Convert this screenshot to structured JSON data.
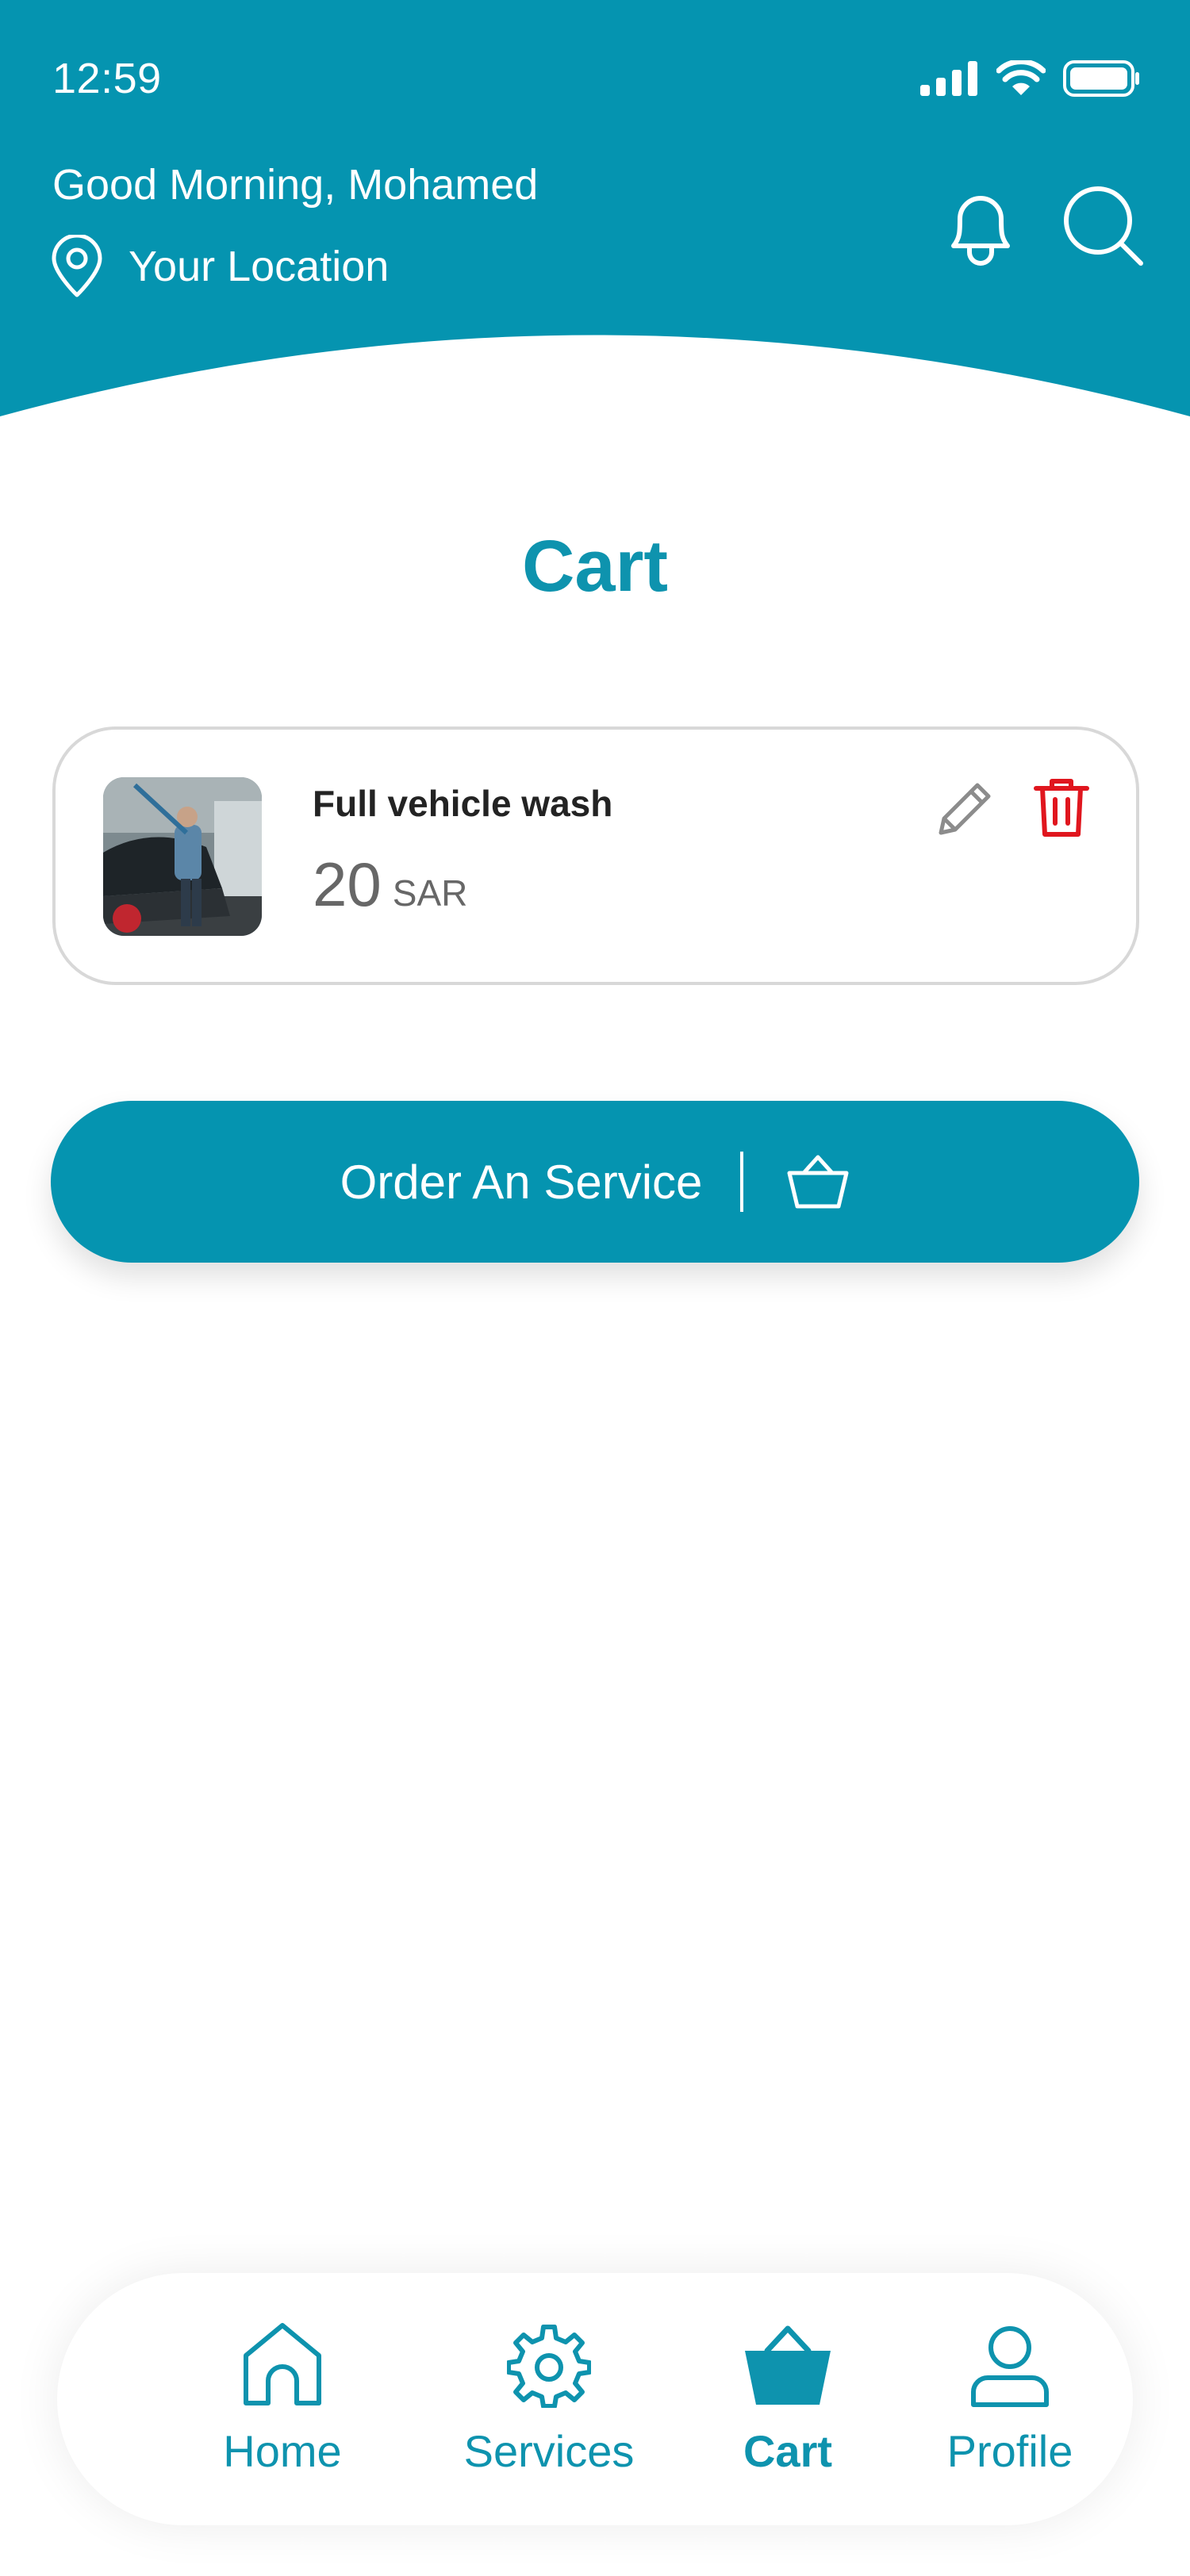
{
  "status_bar": {
    "time": "12:59"
  },
  "header": {
    "greeting": "Good Morning, Mohamed",
    "location_label": "Your Location",
    "icons": [
      "location-pin-icon",
      "bell-icon",
      "search-icon"
    ]
  },
  "page": {
    "title": "Cart"
  },
  "cart": {
    "items": [
      {
        "name": "Full vehicle wash",
        "price": "20",
        "currency": "SAR",
        "image": "car-wash-photo"
      }
    ]
  },
  "order_button": {
    "label": "Order An Service",
    "icon": "basket-icon"
  },
  "bottom_nav": {
    "items": [
      {
        "label": "Home",
        "icon": "home-icon",
        "active": false
      },
      {
        "label": "Services",
        "icon": "gear-icon",
        "active": false
      },
      {
        "label": "Cart",
        "icon": "basket-icon",
        "active": true
      },
      {
        "label": "Profile",
        "icon": "user-icon",
        "active": false
      }
    ]
  },
  "colors": {
    "primary": "#0594b0",
    "title": "#0e93ae",
    "delete": "#e0161e",
    "edit": "#8c8c8c",
    "card_border": "#d8d8d8"
  }
}
